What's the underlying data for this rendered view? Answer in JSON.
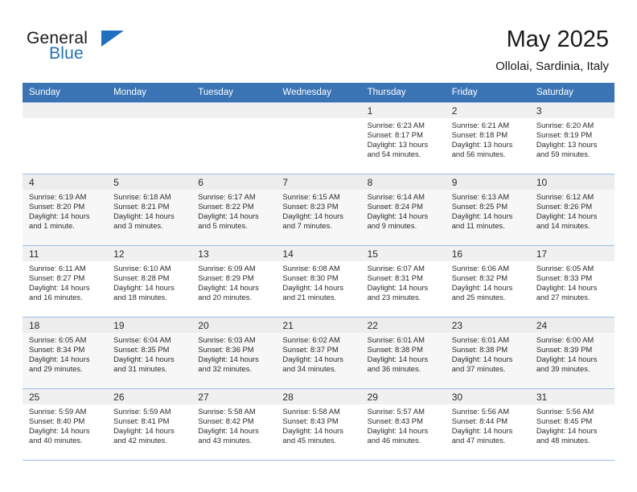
{
  "brand": {
    "name_top": "General",
    "name_bottom": "Blue",
    "accent_color": "#1f70c1"
  },
  "header": {
    "title": "May 2025",
    "location": "Ollolai, Sardinia, Italy"
  },
  "theme": {
    "header_row_bg": "#3a74b5",
    "header_row_text": "#ffffff",
    "grid_line": "#9dbce0",
    "daynum_bg": "#f0f0f0",
    "shaded_row_bg": "#f7f7f7"
  },
  "weekdays": [
    "Sunday",
    "Monday",
    "Tuesday",
    "Wednesday",
    "Thursday",
    "Friday",
    "Saturday"
  ],
  "labels": {
    "sunrise": "Sunrise:",
    "sunset": "Sunset:",
    "daylight": "Daylight:"
  },
  "weeks": [
    {
      "shaded": false,
      "days": [
        {
          "num": "",
          "empty": true
        },
        {
          "num": "",
          "empty": true
        },
        {
          "num": "",
          "empty": true
        },
        {
          "num": "",
          "empty": true
        },
        {
          "num": "1",
          "sunrise": "Sunrise: 6:23 AM",
          "sunset": "Sunset: 8:17 PM",
          "daylight1": "Daylight: 13 hours",
          "daylight2": "and 54 minutes."
        },
        {
          "num": "2",
          "sunrise": "Sunrise: 6:21 AM",
          "sunset": "Sunset: 8:18 PM",
          "daylight1": "Daylight: 13 hours",
          "daylight2": "and 56 minutes."
        },
        {
          "num": "3",
          "sunrise": "Sunrise: 6:20 AM",
          "sunset": "Sunset: 8:19 PM",
          "daylight1": "Daylight: 13 hours",
          "daylight2": "and 59 minutes."
        }
      ]
    },
    {
      "shaded": true,
      "days": [
        {
          "num": "4",
          "sunrise": "Sunrise: 6:19 AM",
          "sunset": "Sunset: 8:20 PM",
          "daylight1": "Daylight: 14 hours",
          "daylight2": "and 1 minute."
        },
        {
          "num": "5",
          "sunrise": "Sunrise: 6:18 AM",
          "sunset": "Sunset: 8:21 PM",
          "daylight1": "Daylight: 14 hours",
          "daylight2": "and 3 minutes."
        },
        {
          "num": "6",
          "sunrise": "Sunrise: 6:17 AM",
          "sunset": "Sunset: 8:22 PM",
          "daylight1": "Daylight: 14 hours",
          "daylight2": "and 5 minutes."
        },
        {
          "num": "7",
          "sunrise": "Sunrise: 6:15 AM",
          "sunset": "Sunset: 8:23 PM",
          "daylight1": "Daylight: 14 hours",
          "daylight2": "and 7 minutes."
        },
        {
          "num": "8",
          "sunrise": "Sunrise: 6:14 AM",
          "sunset": "Sunset: 8:24 PM",
          "daylight1": "Daylight: 14 hours",
          "daylight2": "and 9 minutes."
        },
        {
          "num": "9",
          "sunrise": "Sunrise: 6:13 AM",
          "sunset": "Sunset: 8:25 PM",
          "daylight1": "Daylight: 14 hours",
          "daylight2": "and 11 minutes."
        },
        {
          "num": "10",
          "sunrise": "Sunrise: 6:12 AM",
          "sunset": "Sunset: 8:26 PM",
          "daylight1": "Daylight: 14 hours",
          "daylight2": "and 14 minutes."
        }
      ]
    },
    {
      "shaded": false,
      "days": [
        {
          "num": "11",
          "sunrise": "Sunrise: 6:11 AM",
          "sunset": "Sunset: 8:27 PM",
          "daylight1": "Daylight: 14 hours",
          "daylight2": "and 16 minutes."
        },
        {
          "num": "12",
          "sunrise": "Sunrise: 6:10 AM",
          "sunset": "Sunset: 8:28 PM",
          "daylight1": "Daylight: 14 hours",
          "daylight2": "and 18 minutes."
        },
        {
          "num": "13",
          "sunrise": "Sunrise: 6:09 AM",
          "sunset": "Sunset: 8:29 PM",
          "daylight1": "Daylight: 14 hours",
          "daylight2": "and 20 minutes."
        },
        {
          "num": "14",
          "sunrise": "Sunrise: 6:08 AM",
          "sunset": "Sunset: 8:30 PM",
          "daylight1": "Daylight: 14 hours",
          "daylight2": "and 21 minutes."
        },
        {
          "num": "15",
          "sunrise": "Sunrise: 6:07 AM",
          "sunset": "Sunset: 8:31 PM",
          "daylight1": "Daylight: 14 hours",
          "daylight2": "and 23 minutes."
        },
        {
          "num": "16",
          "sunrise": "Sunrise: 6:06 AM",
          "sunset": "Sunset: 8:32 PM",
          "daylight1": "Daylight: 14 hours",
          "daylight2": "and 25 minutes."
        },
        {
          "num": "17",
          "sunrise": "Sunrise: 6:05 AM",
          "sunset": "Sunset: 8:33 PM",
          "daylight1": "Daylight: 14 hours",
          "daylight2": "and 27 minutes."
        }
      ]
    },
    {
      "shaded": true,
      "days": [
        {
          "num": "18",
          "sunrise": "Sunrise: 6:05 AM",
          "sunset": "Sunset: 8:34 PM",
          "daylight1": "Daylight: 14 hours",
          "daylight2": "and 29 minutes."
        },
        {
          "num": "19",
          "sunrise": "Sunrise: 6:04 AM",
          "sunset": "Sunset: 8:35 PM",
          "daylight1": "Daylight: 14 hours",
          "daylight2": "and 31 minutes."
        },
        {
          "num": "20",
          "sunrise": "Sunrise: 6:03 AM",
          "sunset": "Sunset: 8:36 PM",
          "daylight1": "Daylight: 14 hours",
          "daylight2": "and 32 minutes."
        },
        {
          "num": "21",
          "sunrise": "Sunrise: 6:02 AM",
          "sunset": "Sunset: 8:37 PM",
          "daylight1": "Daylight: 14 hours",
          "daylight2": "and 34 minutes."
        },
        {
          "num": "22",
          "sunrise": "Sunrise: 6:01 AM",
          "sunset": "Sunset: 8:38 PM",
          "daylight1": "Daylight: 14 hours",
          "daylight2": "and 36 minutes."
        },
        {
          "num": "23",
          "sunrise": "Sunrise: 6:01 AM",
          "sunset": "Sunset: 8:38 PM",
          "daylight1": "Daylight: 14 hours",
          "daylight2": "and 37 minutes."
        },
        {
          "num": "24",
          "sunrise": "Sunrise: 6:00 AM",
          "sunset": "Sunset: 8:39 PM",
          "daylight1": "Daylight: 14 hours",
          "daylight2": "and 39 minutes."
        }
      ]
    },
    {
      "shaded": false,
      "days": [
        {
          "num": "25",
          "sunrise": "Sunrise: 5:59 AM",
          "sunset": "Sunset: 8:40 PM",
          "daylight1": "Daylight: 14 hours",
          "daylight2": "and 40 minutes."
        },
        {
          "num": "26",
          "sunrise": "Sunrise: 5:59 AM",
          "sunset": "Sunset: 8:41 PM",
          "daylight1": "Daylight: 14 hours",
          "daylight2": "and 42 minutes."
        },
        {
          "num": "27",
          "sunrise": "Sunrise: 5:58 AM",
          "sunset": "Sunset: 8:42 PM",
          "daylight1": "Daylight: 14 hours",
          "daylight2": "and 43 minutes."
        },
        {
          "num": "28",
          "sunrise": "Sunrise: 5:58 AM",
          "sunset": "Sunset: 8:43 PM",
          "daylight1": "Daylight: 14 hours",
          "daylight2": "and 45 minutes."
        },
        {
          "num": "29",
          "sunrise": "Sunrise: 5:57 AM",
          "sunset": "Sunset: 8:43 PM",
          "daylight1": "Daylight: 14 hours",
          "daylight2": "and 46 minutes."
        },
        {
          "num": "30",
          "sunrise": "Sunrise: 5:56 AM",
          "sunset": "Sunset: 8:44 PM",
          "daylight1": "Daylight: 14 hours",
          "daylight2": "and 47 minutes."
        },
        {
          "num": "31",
          "sunrise": "Sunrise: 5:56 AM",
          "sunset": "Sunset: 8:45 PM",
          "daylight1": "Daylight: 14 hours",
          "daylight2": "and 48 minutes."
        }
      ]
    }
  ]
}
